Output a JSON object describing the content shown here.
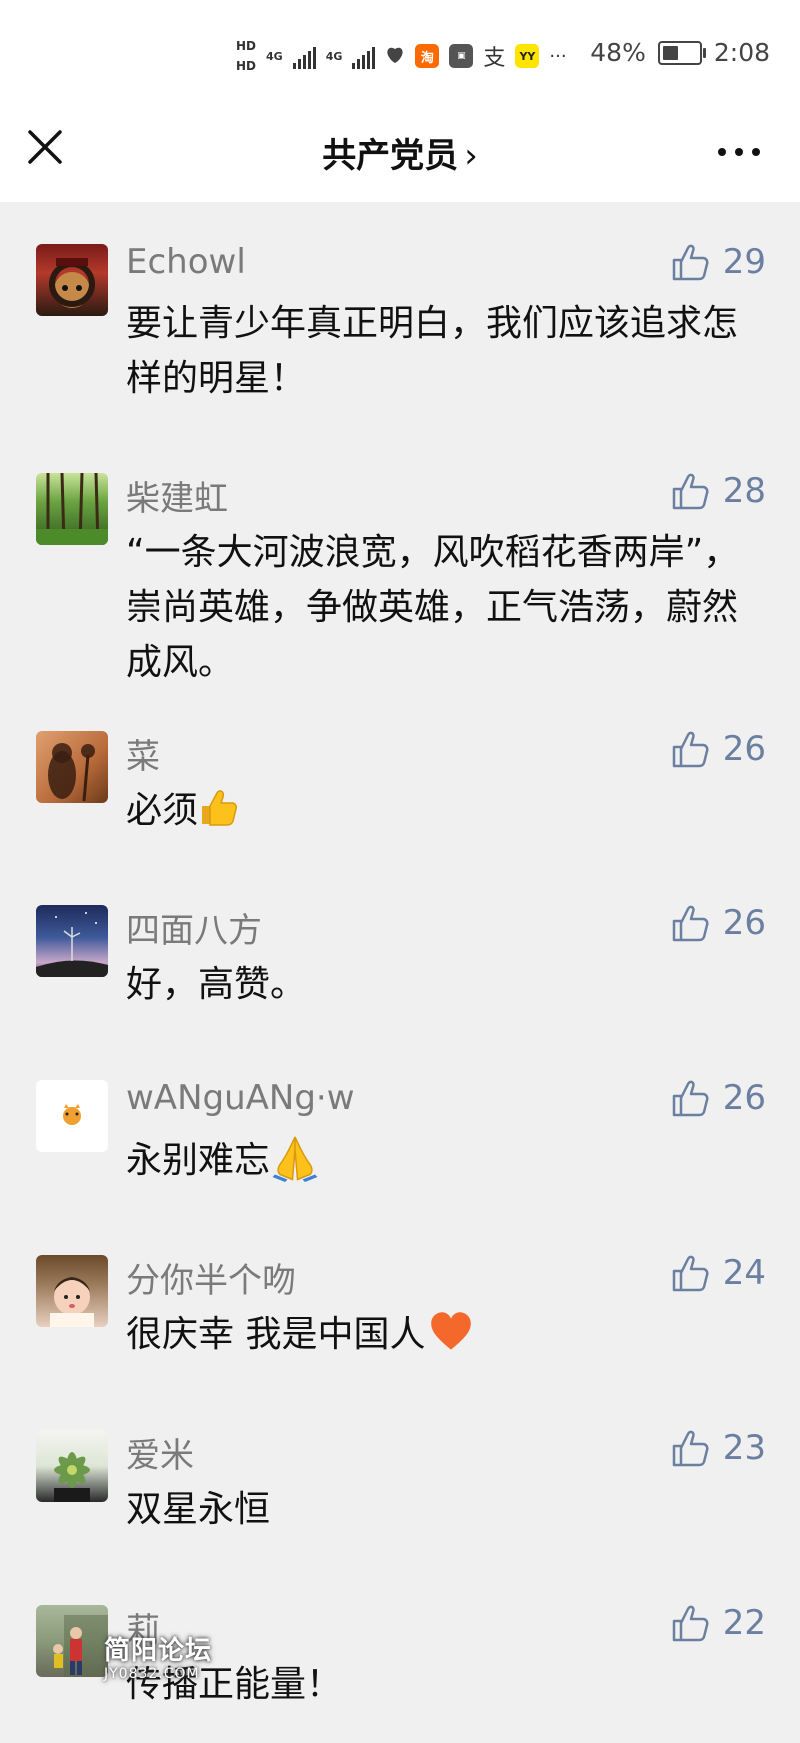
{
  "status_bar": {
    "hd1": "HD",
    "hd2": "HD",
    "net1": "4G",
    "net2": "4G",
    "app_taobao": "淘",
    "app_pay": "支",
    "app_yy": "YY",
    "more": "···",
    "battery": "48%",
    "time": "2:08"
  },
  "nav": {
    "title": "共产党员",
    "chevron": "›"
  },
  "comments": [
    {
      "name": "Echowl",
      "text": "要让青少年真正明白，我们应该追求怎样的明星！",
      "likes": "29",
      "avatar": "avatar-echowl"
    },
    {
      "name": "柴建虹",
      "text": "“一条大河波浪宽，风吹稻花香两岸”，崇尚英雄，争做英雄，正气浩荡，蔚然成风。",
      "likes": "28",
      "avatar": "avatar-forest"
    },
    {
      "name": "菜",
      "text": "必须",
      "likes": "26",
      "avatar": "avatar-silhouette",
      "emoji": "thumbs-up-emoji"
    },
    {
      "name": "四面八方",
      "text": "好，高赞。",
      "likes": "26",
      "avatar": "avatar-nightsky"
    },
    {
      "name": "wANguANg·w",
      "text": "永别难忘",
      "likes": "26",
      "avatar": "avatar-tiger",
      "emoji": "praying-hands-emoji"
    },
    {
      "name": "分你半个吻",
      "text": "很庆幸 我是中国人",
      "likes": "24",
      "avatar": "avatar-child",
      "emoji": "heart-emoji"
    },
    {
      "name": "爱米",
      "text": "双星永恒",
      "likes": "23",
      "avatar": "avatar-succulent"
    },
    {
      "name": "莉",
      "text": "传播正能量！",
      "likes": "22",
      "avatar": "avatar-kids"
    }
  ],
  "watermark": {
    "main": "简阳论坛",
    "sub": "JY0832.COM"
  },
  "colors": {
    "background": "#f0f0f0",
    "like": "#6b7fa0",
    "name": "#7a7a7a"
  }
}
